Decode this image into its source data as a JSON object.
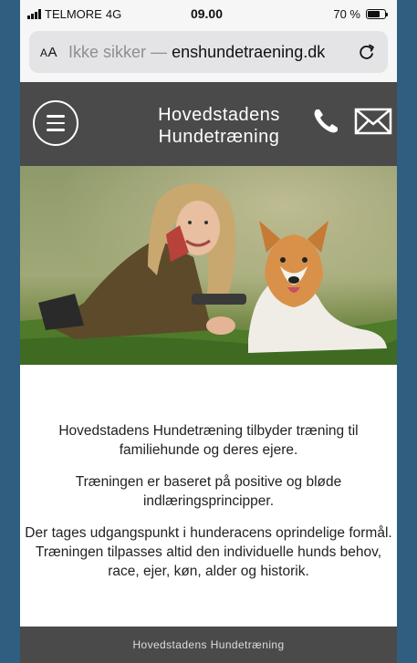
{
  "status_bar": {
    "carrier": "TELMORE",
    "network": "4G",
    "time": "09.00",
    "battery_text": "70 %",
    "battery_level": 0.7
  },
  "address_bar": {
    "text_size_label": "AA",
    "security_label": "Ikke sikker —",
    "domain": "enshundetraening.dk",
    "reload_icon": "reload-icon"
  },
  "header": {
    "menu_icon": "hamburger-menu-icon",
    "title_line1": "Hovedstadens",
    "title_line2": "Hundetræning",
    "phone_icon": "phone-icon",
    "mail_icon": "mail-icon",
    "bg_color": "#4a4a4a"
  },
  "hero": {
    "subject": "woman-with-dog-photo"
  },
  "content": {
    "paragraphs": [
      "Hovedstadens Hundetræning tilbyder træning til familiehunde og deres ejere.",
      "Træningen er baseret på positive og bløde indlæringsprincipper.",
      "Der tages udgangspunkt i hunderacens oprindelige formål. Træningen tilpasses altid den individuelle hunds behov, race, ejer, køn, alder og historik."
    ]
  },
  "footer": {
    "text": "Hovedstadens Hundetræning"
  }
}
